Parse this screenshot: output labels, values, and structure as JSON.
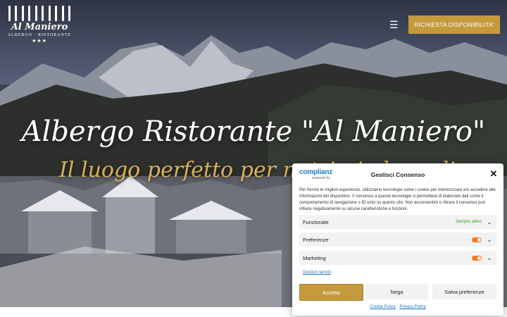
{
  "header": {
    "logo": {
      "name": "Al Maniero",
      "subtitle": "ALBERGO · RISTORANTE",
      "stars": "★★★"
    },
    "menu_icon": "☰",
    "cta_label": "RICHIESTA DISPONIBILITA'"
  },
  "hero": {
    "title": "Albergo Ristorante \"Al Maniero\"",
    "subtitle": "Il luogo perfetto per nutrirsi al meglio"
  },
  "consent": {
    "brand": "complianz",
    "brand_sub": "powered by",
    "title": "Gestisci Consenso",
    "close_icon": "✕",
    "description": "Per fornire le migliori esperienze, utilizziamo tecnologie come i cookie per memorizzare e/o accedere alle informazioni del dispositivo. Il consenso a queste tecnologie ci permetterà di elaborare dati come il comportamento di navigazione o ID unici su questo sito. Non acconsentire o ritirare il consenso può influire negativamente su alcune caratteristiche e funzioni.",
    "categories": [
      {
        "label": "Funzionale",
        "status": "Sempre attivo"
      },
      {
        "label": "Preferenze"
      },
      {
        "label": "Marketing"
      }
    ],
    "manage_services": "Gestisci servizi",
    "accept": "Accetta",
    "deny": "Nega",
    "save": "Salva preferenze",
    "links": [
      "Cookie Policy",
      "Privacy Policy"
    ],
    "colors": {
      "accent": "#c49a3d",
      "toggle": "#f47c20",
      "link": "#1a6fc1"
    }
  }
}
